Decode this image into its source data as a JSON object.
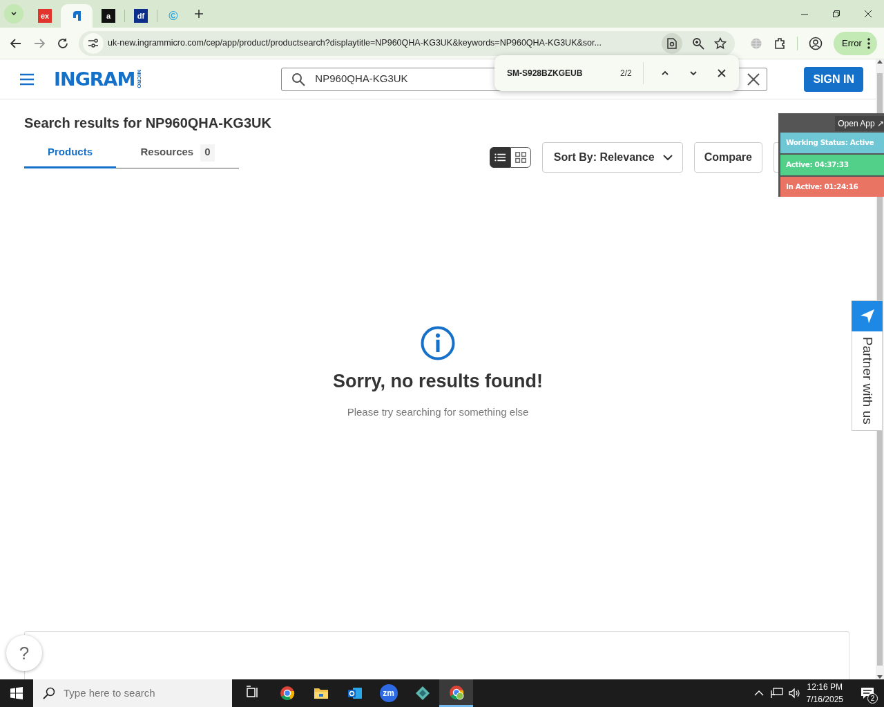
{
  "browser": {
    "tabs": [
      {
        "kind": "letters",
        "label": "ex",
        "color": "#e0342c",
        "selected": false
      },
      {
        "kind": "ingram",
        "selected": true
      },
      {
        "kind": "letters",
        "label": "a",
        "color": "#111111",
        "selected": false
      },
      {
        "kind": "letters",
        "label": "df",
        "color": "#0b2f8a",
        "selected": false
      },
      {
        "kind": "letters",
        "label": "©",
        "color": "#2aa7e0",
        "selected": false
      }
    ],
    "url": "uk-new.ingrammicro.com/cep/app/product/productsearch?displaytitle=NP960QHA-KG3UK&keywords=NP960QHA-KG3UK&sor...",
    "profile_status": "Error",
    "find_bar": {
      "query": "SM-S928BZKGEUB",
      "count": "2/2"
    }
  },
  "site_header": {
    "logo": "INGRAM",
    "logo_sub": "MICRO",
    "search_value": "NP960QHA-KG3UK",
    "sign_in": "SIGN IN"
  },
  "results": {
    "heading": "Search results for NP960QHA-KG3UK",
    "tabs": [
      {
        "label": "Products",
        "selected": true
      },
      {
        "label": "Resources",
        "count": "0",
        "selected": false
      }
    ],
    "views": [
      {
        "kind": "list",
        "selected": true
      },
      {
        "kind": "grid",
        "selected": false
      }
    ],
    "sort": "Sort By: Relevance",
    "compare": "Compare",
    "empty_title": "Sorry, no results found!",
    "empty_message": "Please try searching for something else"
  },
  "tracker": {
    "open_app": "Open App ↗",
    "rows": [
      {
        "label": "Working Status: Active",
        "color": "#6fc6d4"
      },
      {
        "label": "Active: 04:37:33",
        "color": "#52cf88"
      },
      {
        "label": "In Active: 01:24:16",
        "color": "#ea7464"
      }
    ]
  },
  "partner": "Partner with us",
  "help": "?",
  "taskbar": {
    "search_placeholder": "Type here to search",
    "apps": [
      {
        "kind": "taskview",
        "selected": false
      },
      {
        "kind": "chrome",
        "selected": false
      },
      {
        "kind": "folder",
        "selected": false
      },
      {
        "kind": "outlook",
        "selected": false
      },
      {
        "kind": "zoom",
        "label": "zm",
        "selected": false
      },
      {
        "kind": "diamond",
        "selected": false
      },
      {
        "kind": "chrome-profile",
        "selected": true
      }
    ],
    "time": "12:16 PM",
    "date": "7/16/2025",
    "notifications": "2"
  }
}
